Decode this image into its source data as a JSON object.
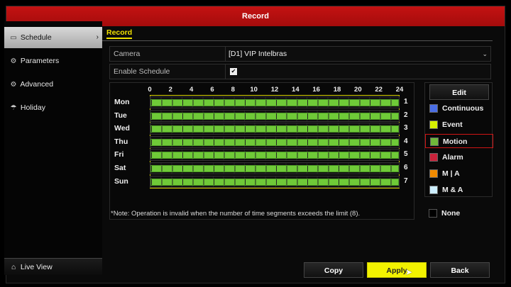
{
  "window": {
    "title": "Record"
  },
  "sidebar": {
    "items": [
      {
        "label": "Schedule",
        "icon": "schedule-icon",
        "glyph": "▭",
        "active": true
      },
      {
        "label": "Parameters",
        "icon": "parameters-icon",
        "glyph": "⚙"
      },
      {
        "label": "Advanced",
        "icon": "advanced-icon",
        "glyph": "⚙"
      },
      {
        "label": "Holiday",
        "icon": "holiday-icon",
        "glyph": "☂"
      }
    ],
    "active_chevron": "›",
    "live_view": {
      "label": "Live View",
      "glyph": "⌂"
    }
  },
  "tabs": {
    "active": "Record"
  },
  "form": {
    "camera_label": "Camera",
    "camera_value": "[D1] VIP Intelbras",
    "camera_arrow": "⌄",
    "enable_label": "Enable Schedule",
    "enable_checked": "✔"
  },
  "schedule": {
    "hours": [
      "0",
      "2",
      "4",
      "6",
      "8",
      "10",
      "12",
      "14",
      "16",
      "18",
      "20",
      "22",
      "24"
    ],
    "days": [
      "Mon",
      "Tue",
      "Wed",
      "Thu",
      "Fri",
      "Sat",
      "Sun"
    ],
    "indices": [
      "1",
      "2",
      "3",
      "4",
      "5",
      "6",
      "7"
    ],
    "fill_fraction": 1.0,
    "bar_color": "#6fca38"
  },
  "note": "*Note: Operation is invalid when the number of time segments exceeds the limit (8).",
  "legend": {
    "edit_label": "Edit",
    "items": [
      {
        "label": "Continuous",
        "color": "#4a6ee6"
      },
      {
        "label": "Event",
        "color": "#d6f000"
      },
      {
        "label": "Motion",
        "color": "#6fb83a",
        "selected": true
      },
      {
        "label": "Alarm",
        "color": "#c8223a"
      },
      {
        "label": "M | A",
        "color": "#f08a00"
      },
      {
        "label": "M & A",
        "color": "#cceeff"
      }
    ],
    "none_label": "None"
  },
  "buttons": {
    "copy": "Copy",
    "apply": "Apply",
    "back": "Back"
  }
}
